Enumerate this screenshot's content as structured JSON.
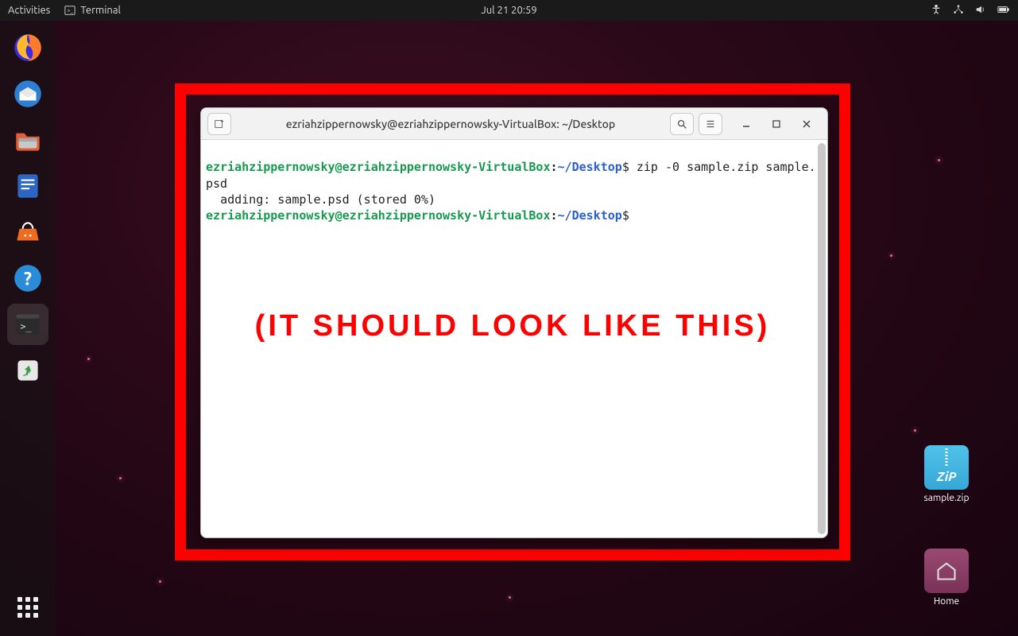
{
  "topbar": {
    "activities": "Activities",
    "app_label": "Terminal",
    "clock": "Jul 21  20:59"
  },
  "dock": {
    "items": [
      {
        "name": "firefox",
        "color": "#ff7b2e"
      },
      {
        "name": "thunderbird",
        "color": "#2d7fd3"
      },
      {
        "name": "files",
        "color": "#ffa24a"
      },
      {
        "name": "writer",
        "color": "#2a66c2"
      },
      {
        "name": "software",
        "color": "#ef6c1f"
      },
      {
        "name": "help",
        "color": "#2a8bd6"
      },
      {
        "name": "terminal",
        "color": "#2b2b2b"
      },
      {
        "name": "trash",
        "color": "#e8e8e8"
      }
    ]
  },
  "desktop": {
    "zip_label": "sample.zip",
    "zip_badge": "ZiP",
    "home_label": "Home"
  },
  "terminal": {
    "title": "ezriahzippernowsky@ezriahzippernowsky-VirtualBox: ~/Desktop",
    "prompt": {
      "user": "ezriahzippernowsky",
      "at": "@",
      "host": "ezriahzippernowsky-VirtualBox",
      "colon": ":",
      "path": "~/Desktop",
      "dollar": "$"
    },
    "cmd1": " zip -0 sample.zip sample.psd",
    "out1": "  adding: sample.psd (stored 0%)",
    "cmd2": " "
  },
  "overlay": "(IT SHOULD LOOK LIKE THIS)"
}
